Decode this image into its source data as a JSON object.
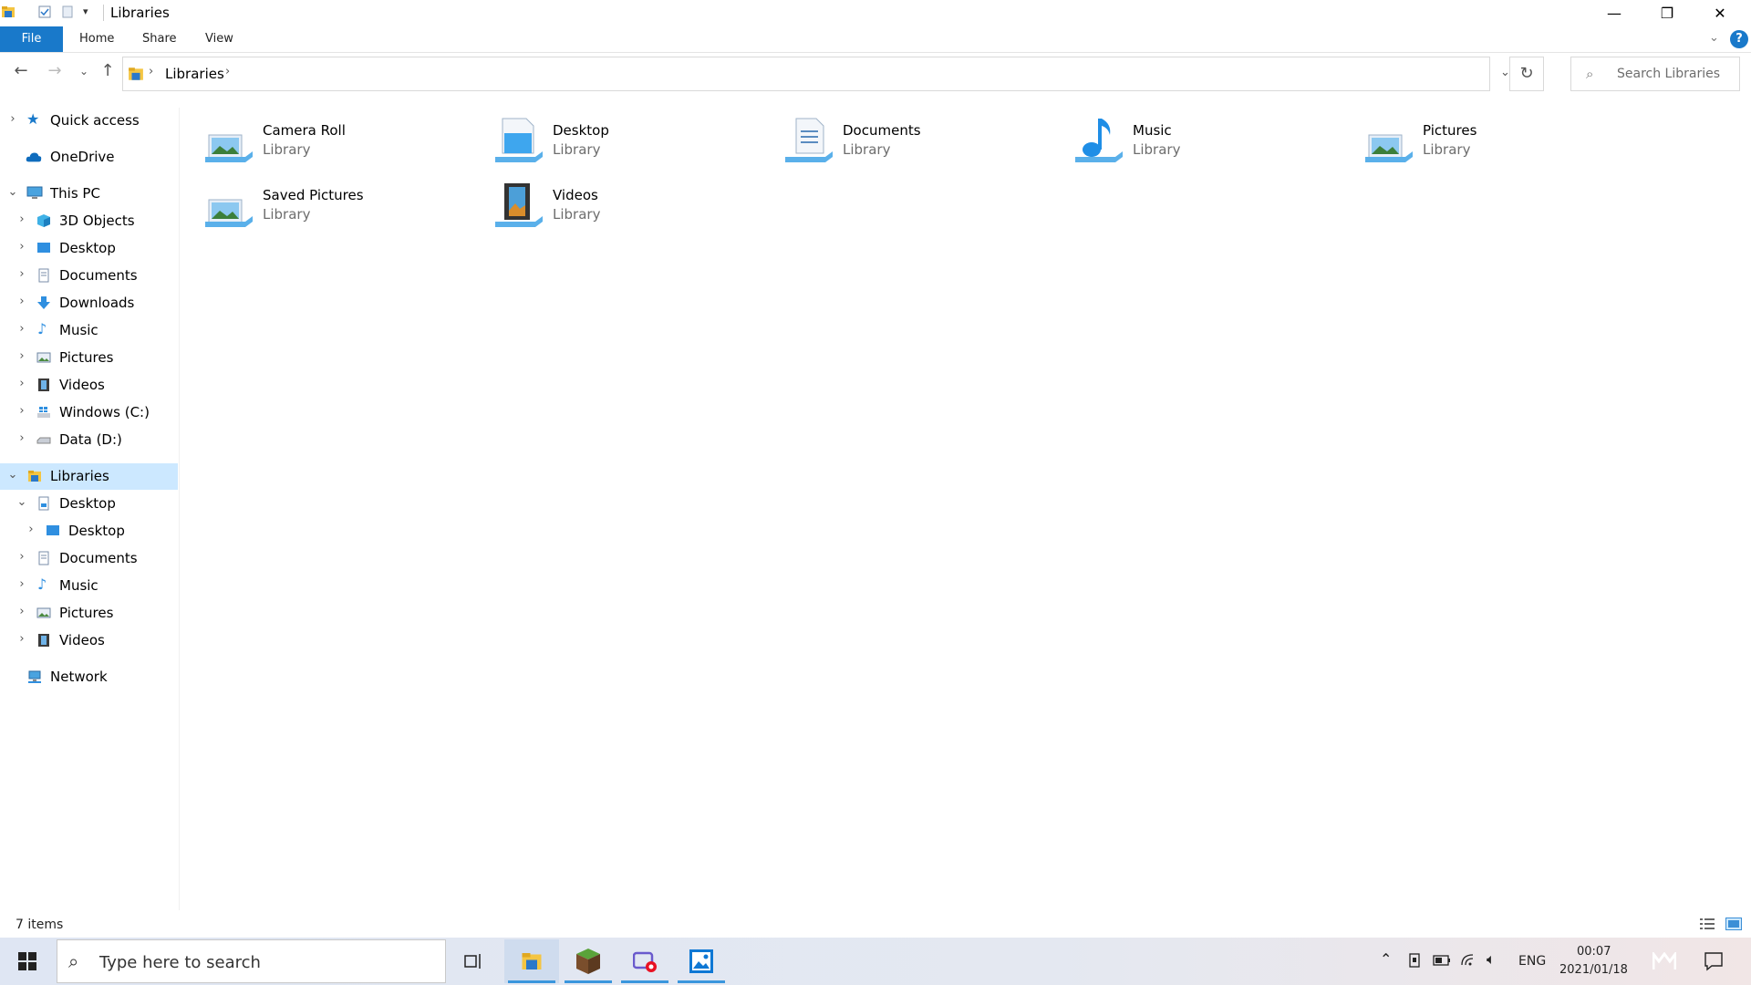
{
  "window": {
    "title": "Libraries",
    "controls": {
      "minimize": "—",
      "restore": "❐",
      "close": "✕"
    }
  },
  "ribbon": {
    "tabs": [
      "File",
      "Home",
      "Share",
      "View"
    ],
    "help": "?"
  },
  "address": {
    "crumbs": [
      "Libraries"
    ],
    "search_placeholder": "Search Libraries"
  },
  "nav": {
    "quick_access": "Quick access",
    "onedrive": "OneDrive",
    "this_pc": "This PC",
    "pc_items": [
      "3D Objects",
      "Desktop",
      "Documents",
      "Downloads",
      "Music",
      "Pictures",
      "Videos",
      "Windows (C:)",
      "Data (D:)"
    ],
    "libraries": "Libraries",
    "lib_items": [
      "Desktop",
      "Desktop",
      "Documents",
      "Music",
      "Pictures",
      "Videos"
    ],
    "network": "Network"
  },
  "content": {
    "libraries": [
      {
        "name": "Camera Roll",
        "type": "Library",
        "icon": "pictures-library-icon"
      },
      {
        "name": "Desktop",
        "type": "Library",
        "icon": "desktop-library-icon"
      },
      {
        "name": "Documents",
        "type": "Library",
        "icon": "documents-library-icon"
      },
      {
        "name": "Music",
        "type": "Library",
        "icon": "music-library-icon"
      },
      {
        "name": "Pictures",
        "type": "Library",
        "icon": "pictures-library-icon"
      },
      {
        "name": "Saved Pictures",
        "type": "Library",
        "icon": "pictures-library-icon"
      },
      {
        "name": "Videos",
        "type": "Library",
        "icon": "videos-library-icon"
      }
    ]
  },
  "status": {
    "item_count": "7 items"
  },
  "taskbar": {
    "search_placeholder": "Type here to search",
    "language": "ENG",
    "time": "00:07",
    "date": "2021/01/18"
  },
  "colors": {
    "accent": "#1979ca",
    "selection": "#cce8ff"
  }
}
